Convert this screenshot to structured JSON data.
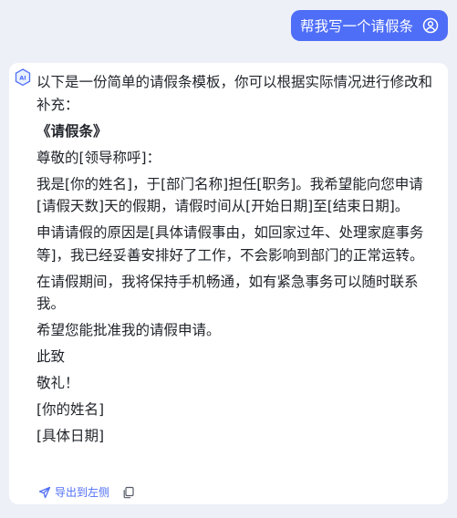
{
  "user_message": {
    "text": "帮我写一个请假条",
    "avatar_icon": "user-circle-icon"
  },
  "reply": {
    "avatar_icon": "ai-assistant-icon",
    "paragraphs": [
      "以下是一份简单的请假条模板，你可以根据实际情况进行修改和补充：",
      "《请假条》",
      "尊敬的[领导称呼]：",
      "我是[你的姓名]，于[部门名称]担任[职务]。我希望能向您申请[请假天数]天的假期，请假时间从[开始日期]至[结束日期]。",
      "申请请假的原因是[具体请假事由，如回家过年、处理家庭事务等]，我已经妥善安排好了工作，不会影响到部门的正常运转。",
      "在请假期间，我将保持手机畅通，如有紧急事务可以随时联系我。",
      "希望您能批准我的请假申请。",
      "此致",
      "敬礼！",
      "[你的姓名]",
      "[具体日期]"
    ],
    "actions": {
      "export_label": "导出到左侧",
      "export_icon": "send-icon",
      "copy_icon": "copy-icon"
    }
  },
  "colors": {
    "accent": "#4f6ef7",
    "background": "#eef0f8",
    "card": "#ffffff",
    "text": "#1f2329"
  }
}
